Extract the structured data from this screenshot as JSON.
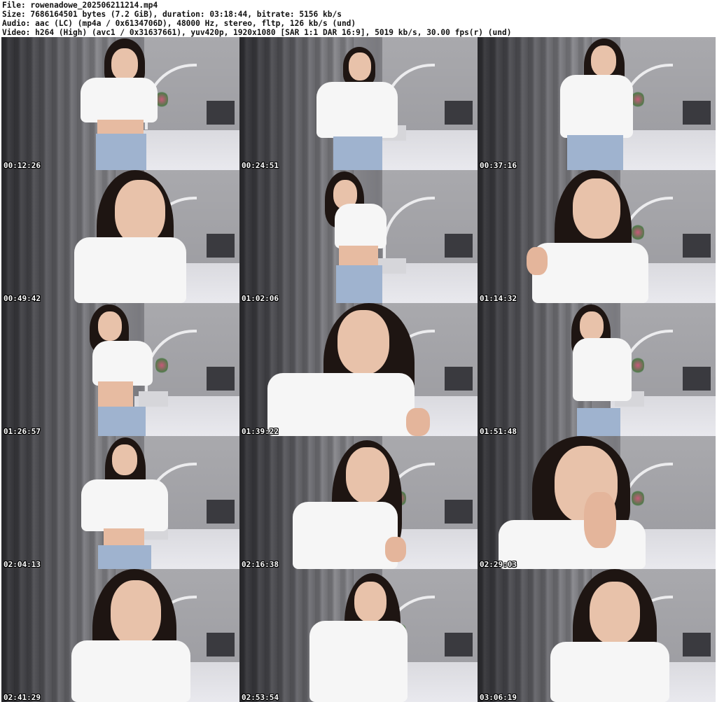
{
  "header": {
    "file": "File: rowenadowe_202506211214.mp4",
    "size": "Size: 7686164501 bytes (7.2 GiB), duration: 03:18:44, bitrate: 5156 kb/s",
    "audio": "Audio: aac (LC) (mp4a / 0x6134706D), 48000 Hz, stereo, fltp, 126 kb/s (und)",
    "video": "Video: h264 (High) (avc1 / 0x31637661), yuv420p, 1920x1080 [SAR 1:1 DAR 16:9], 5019 kb/s, 30.00 fps(r) (und)"
  },
  "thumbnails": [
    {
      "timestamp": "00:12:26"
    },
    {
      "timestamp": "00:24:51"
    },
    {
      "timestamp": "00:37:16"
    },
    {
      "timestamp": "00:49:42"
    },
    {
      "timestamp": "01:02:06"
    },
    {
      "timestamp": "01:14:32"
    },
    {
      "timestamp": "01:26:57"
    },
    {
      "timestamp": "01:39:22"
    },
    {
      "timestamp": "01:51:48"
    },
    {
      "timestamp": "02:04:13"
    },
    {
      "timestamp": "02:16:38"
    },
    {
      "timestamp": "02:29:03"
    },
    {
      "timestamp": "02:41:29"
    },
    {
      "timestamp": "02:53:54"
    },
    {
      "timestamp": "03:06:19"
    }
  ],
  "colors": {
    "stamp_text": "#ffffff",
    "stamp_outline": "#000000",
    "header_text": "#111111",
    "background": "#ffffff"
  }
}
